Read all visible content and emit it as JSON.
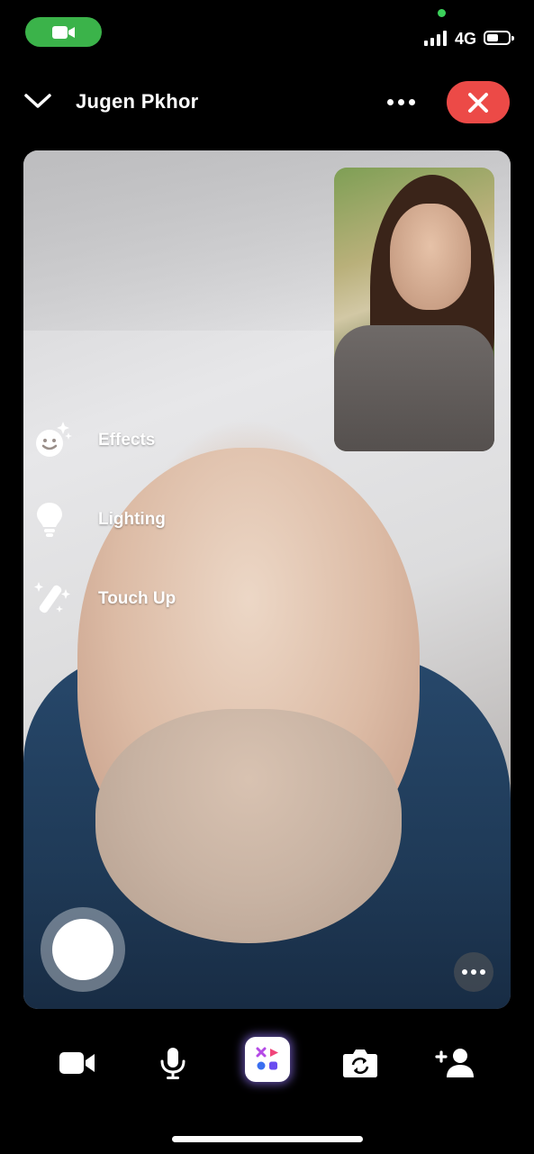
{
  "status_bar": {
    "network": "4G",
    "icons": [
      "video-camera-icon",
      "signal-icon",
      "battery-icon"
    ]
  },
  "header": {
    "caller_name": "Jugen  Pkhor",
    "icons": [
      "chevron-down-icon",
      "more-icon",
      "close-icon"
    ]
  },
  "effects_menu": {
    "items": [
      {
        "label": "Effects",
        "icon": "smiley-sparkle-icon"
      },
      {
        "label": "Lighting",
        "icon": "lightbulb-icon"
      },
      {
        "label": "Touch Up",
        "icon": "magic-wand-icon"
      }
    ]
  },
  "toolbar": {
    "icons": [
      "video-camera-icon",
      "microphone-icon",
      "effects-icon",
      "flip-camera-icon",
      "add-person-icon"
    ]
  },
  "colors": {
    "end_call": "#ec4a47",
    "camera_pill": "#3bb34a",
    "background": "#000000"
  }
}
